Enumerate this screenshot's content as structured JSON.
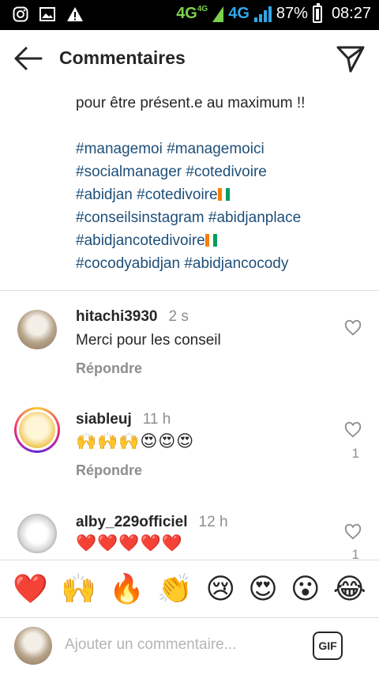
{
  "status": {
    "network_1": "4G",
    "network_1_small": "4G",
    "network_2": "4G",
    "battery": "87%",
    "time": "08:27",
    "icons": [
      "instagram-icon",
      "image-icon",
      "warning-icon",
      "signal-icon",
      "battery-icon"
    ]
  },
  "header": {
    "title": "Commentaires",
    "back_icon": "back-arrow-icon",
    "send_icon": "send-icon"
  },
  "caption": {
    "text": "pour être présent.e au maximum !!",
    "hashtag_lines": [
      "#managemoi #managemoici",
      "#socialmanager #cotedivoire",
      "#abidjan #cotedivoire",
      "#conseilsinstagram #abidjanplace",
      "#abidjancotedivoire",
      "#cocodyabidjan #abidjancocody"
    ],
    "flag_colors": [
      "#F77F00",
      "#FFFFFF",
      "#009E60"
    ]
  },
  "comments": [
    {
      "username": "hitachi3930",
      "time": "2 s",
      "text": "Merci pour les conseil",
      "reply": "Répondre",
      "likes": ""
    },
    {
      "username": "siableuj",
      "time": "11 h",
      "text": "🙌🙌🙌😍😍😍",
      "reply": "Répondre",
      "likes": "1"
    },
    {
      "username": "alby_229officiel",
      "time": "12 h",
      "text": "❤️❤️❤️❤️❤️",
      "reply": "",
      "likes": "1"
    }
  ],
  "emoji_bar": [
    "❤️",
    "🙌",
    "🔥",
    "👏",
    "😢",
    "😍",
    "😮",
    "😂"
  ],
  "input": {
    "placeholder": "Ajouter un commentaire...",
    "gif_label": "GIF"
  }
}
